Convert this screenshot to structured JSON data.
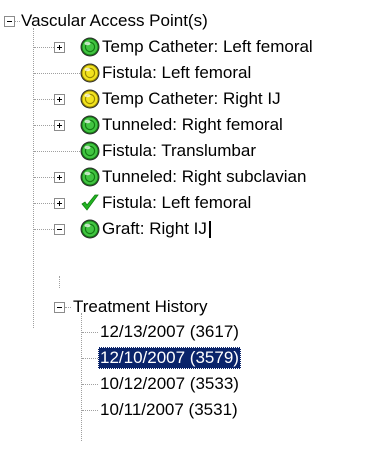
{
  "tree": {
    "root_label": "Vascular Access Point(s)",
    "items": [
      {
        "label": "Temp Catheter:  Left femoral",
        "status": "green",
        "expandable": true
      },
      {
        "label": "Fistula:  Left femoral",
        "status": "yellow",
        "expandable": false
      },
      {
        "label": "Temp Catheter:  Right IJ",
        "status": "yellow",
        "expandable": true
      },
      {
        "label": "Tunneled:  Right femoral",
        "status": "green",
        "expandable": true
      },
      {
        "label": "Fistula:  Translumbar",
        "status": "green",
        "expandable": false
      },
      {
        "label": "Tunneled:  Right subclavian",
        "status": "green",
        "expandable": true
      },
      {
        "label": "Fistula:  Left femoral",
        "status": "check",
        "expandable": true
      },
      {
        "label": "Graft:  Right IJ",
        "status": "green",
        "expandable": true,
        "expanded": true
      }
    ],
    "history_label": "Treatment History",
    "history": [
      {
        "label": "12/13/2007 (3617)",
        "selected": false
      },
      {
        "label": "12/10/2007 (3579)",
        "selected": true
      },
      {
        "label": "10/12/2007 (3533)",
        "selected": false
      },
      {
        "label": "10/11/2007 (3531)",
        "selected": false
      }
    ]
  },
  "colors": {
    "selection": "#0a246a",
    "green_status": "#3cc23c",
    "yellow_status": "#f0e020",
    "check": "#22b422"
  }
}
